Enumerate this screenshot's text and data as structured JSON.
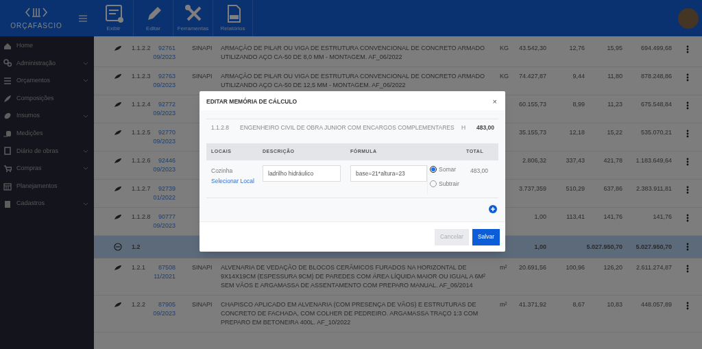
{
  "app": {
    "logo": "ORÇAFASCIO"
  },
  "toolbar": [
    {
      "label": "Exibir"
    },
    {
      "label": "Editar"
    },
    {
      "label": "Ferramentas"
    },
    {
      "label": "Relatórios"
    }
  ],
  "sidebar": {
    "items": [
      {
        "label": "Home",
        "has_submenu": false
      },
      {
        "label": "Administração",
        "has_submenu": true
      },
      {
        "label": "Orçamentos",
        "has_submenu": true
      },
      {
        "label": "Composições",
        "has_submenu": false
      },
      {
        "label": "Insumos",
        "has_submenu": true
      },
      {
        "label": "Medições",
        "has_submenu": false
      },
      {
        "label": "Diário de obras",
        "has_submenu": true
      },
      {
        "label": "Compras",
        "has_submenu": true
      },
      {
        "label": "Planejamentos",
        "has_submenu": false
      },
      {
        "label": "Cadastros",
        "has_submenu": true
      }
    ]
  },
  "table": {
    "rows": [
      {
        "kind": "item",
        "code": "1.1.2.2",
        "ref": "92761",
        "date": "09/2023",
        "source": "SINAPI",
        "description": "ARMAÇÃO DE PILAR OU VIGA DE ESTRUTURA CONVENCIONAL DE CONCRETO ARMADO UTILIZANDO AÇO CA-50 DE 8,0 MM - MONTAGEM. AF_06/2022",
        "unit": "KG",
        "quantity": "43.542,30",
        "unit_cost": "12,76",
        "unit_price": "15,95",
        "total": "694.499,68"
      },
      {
        "kind": "item",
        "code": "1.1.2.3",
        "ref": "92763",
        "date": "09/2023",
        "source": "SINAPI",
        "description": "ARMAÇÃO DE PILAR OU VIGA DE ESTRUTURA CONVENCIONAL DE CONCRETO ARMADO UTILIZANDO AÇO CA-50 DE 12,5 MM - MONTAGEM. AF_06/2022",
        "unit": "KG",
        "quantity": "74.427,87",
        "unit_cost": "9,44",
        "unit_price": "11,80",
        "total": "878.248,86"
      },
      {
        "kind": "item",
        "code": "1.1.2.4",
        "ref": "92772",
        "date": "09/2023",
        "quantity": "60.155,73",
        "unit_cost": "8,99",
        "unit_price": "11,23",
        "total": "675.548,84"
      },
      {
        "kind": "item",
        "code": "1.1.2.5",
        "ref": "92770",
        "date": "09/2023",
        "quantity": "35.155,73",
        "unit_cost": "12,18",
        "unit_price": "15,22",
        "total": "535.070,21"
      },
      {
        "kind": "item",
        "code": "1.1.2.6",
        "ref": "92446",
        "date": "09/2023",
        "quantity": "2.806,32",
        "unit_cost": "337,43",
        "unit_price": "421,78",
        "total": "1.183.649,64"
      },
      {
        "kind": "item",
        "code": "1.1.2.7",
        "ref": "92739",
        "date": "01/2022",
        "quantity": "3.737,359",
        "unit_cost": "510,29",
        "unit_price": "637,86",
        "total": "2.383.911,81"
      },
      {
        "kind": "item",
        "code": "1.1.2.8",
        "ref": "90777",
        "date": "09/2023",
        "quantity": "1,00",
        "unit_cost": "113,41",
        "unit_price": "141,76",
        "total": "141,76"
      },
      {
        "kind": "group",
        "code": "1.2",
        "quantity": "1,00",
        "unit_price": "5.027.950,70",
        "total": "5.027.950,70"
      },
      {
        "kind": "item",
        "code": "1.2.1",
        "ref": "87508",
        "date": "11/2021",
        "source": "SINAPI",
        "description": "ALVENARIA DE VEDAÇÃO DE BLOCOS CERÂMICOS FURADOS NA HORIZONTAL DE 9X14X19CM (ESPESSURA 9CM) DE PAREDES COM ÁREA LÍQUIDA MAIOR OU IGUAL A 6M² SEM VÃOS E ARGAMASSA DE ASSENTAMENTO COM PREPARO MANUAL. AF_06/2014",
        "unit": "m²",
        "quantity": "20.691,56",
        "unit_cost": "100,96",
        "unit_price": "126,20",
        "total": "2.611.274,87"
      },
      {
        "kind": "item",
        "code": "1.2.2",
        "ref": "87905",
        "date": "09/2023",
        "source": "SINAPI",
        "description": "CHAPISCO APLICADO EM ALVENARIA (COM PRESENÇA DE VÃOS) E ESTRUTURAS DE CONCRETO DE FACHADA, COM COLHER DE PEDREIRO. ARGAMASSA TRAÇO 1:3 COM PREPARO EM BETONEIRA 400L. AF_10/2022",
        "unit": "m²",
        "quantity": "41.371,92",
        "unit_cost": "8,67",
        "unit_price": "10,83",
        "total": "448.057,89"
      }
    ]
  },
  "modal": {
    "title": "EDITAR MEMÓRIA DE CÁLCULO",
    "close": "×",
    "item": {
      "code": "1.1.2.8",
      "description": "ENGENHEIRO CIVIL DE OBRA JUNIOR COM ENCARGOS COMPLEMENTARES",
      "unit": "H",
      "quantity": "483,00"
    },
    "columns": [
      "LOCAIS",
      "DESCRIÇÃO",
      "FÓRMULA",
      "TOTAL"
    ],
    "entries": [
      {
        "local": "Cozinha",
        "select_link": "Selecionar Local",
        "description": "ladrilho hidráulico",
        "formula": "base=21*altura=23",
        "options": [
          {
            "label": "Somar",
            "selected": true
          },
          {
            "label": "Subtrair",
            "selected": false
          }
        ],
        "total": "483,00"
      }
    ],
    "buttons": [
      {
        "label": "Cancelar",
        "kind": "secondary",
        "disabled": true
      },
      {
        "label": "Salvar",
        "kind": "primary",
        "disabled": false
      }
    ]
  }
}
